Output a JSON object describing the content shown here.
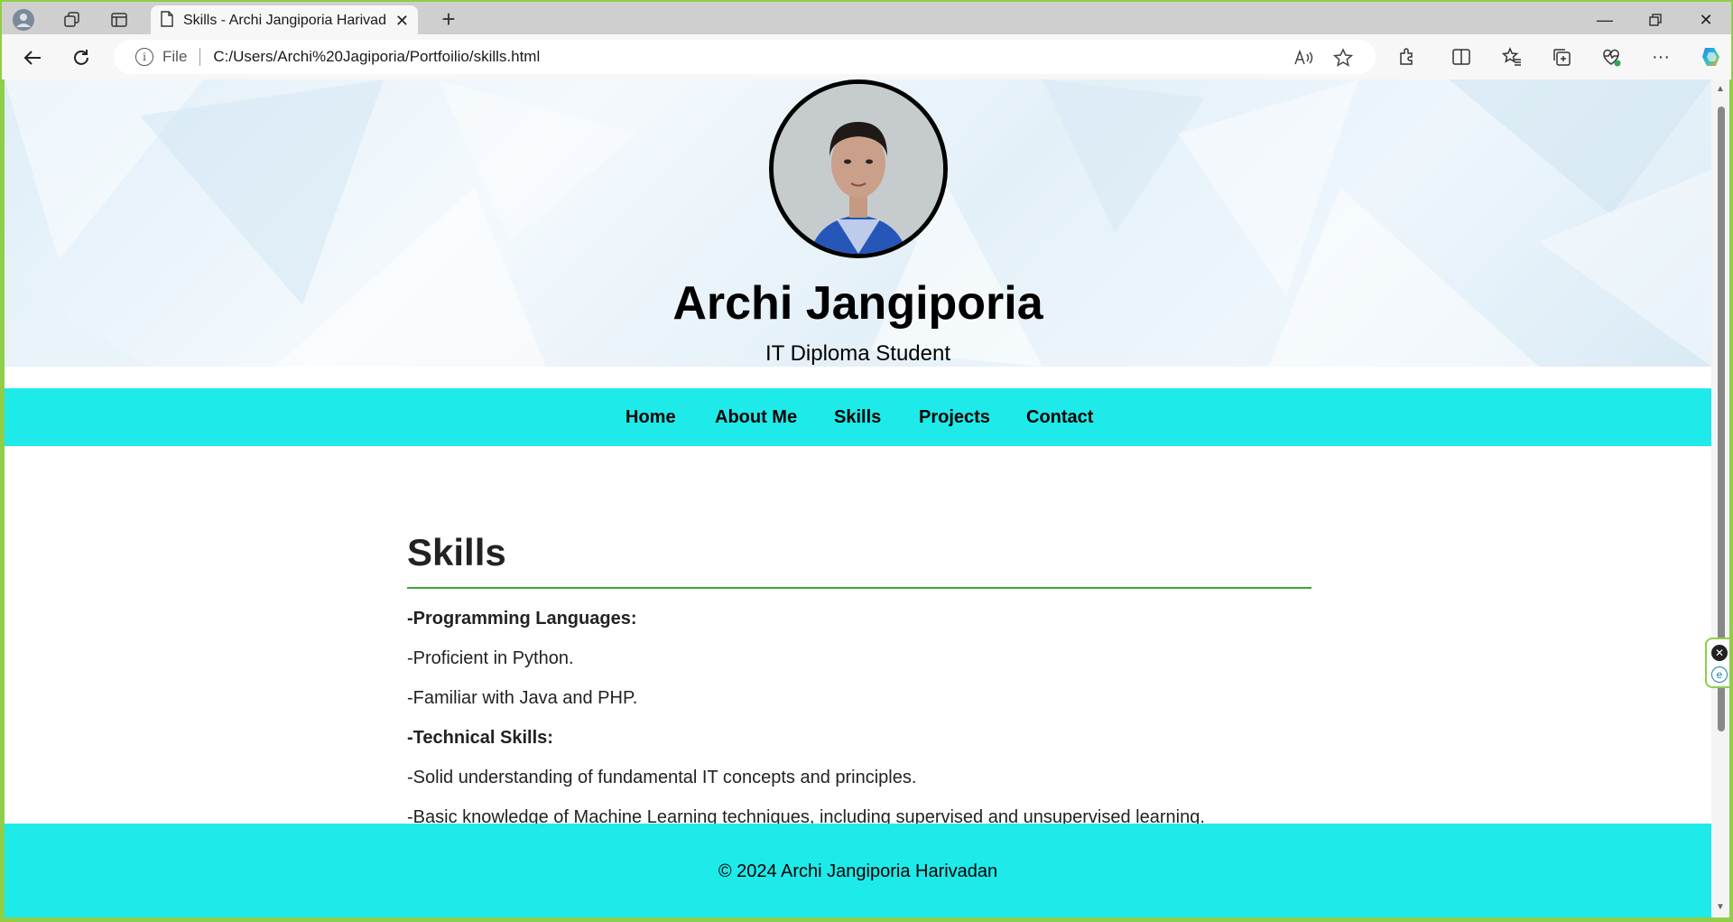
{
  "browser": {
    "tab_title": "Skills - Archi Jangiporia Harivadan",
    "address": {
      "scheme_label": "File",
      "url": "C:/Users/Archi%20Jagiporia/Portfoilio/skills.html"
    }
  },
  "hero": {
    "name": "Archi Jangiporia",
    "role": "IT Diploma Student"
  },
  "nav": {
    "items": [
      "Home",
      "About Me",
      "Skills",
      "Projects",
      "Contact"
    ]
  },
  "skills": {
    "heading": "Skills",
    "lines": [
      {
        "text": "-Programming Languages:",
        "bold": true
      },
      {
        "text": "-Proficient in Python.",
        "bold": false
      },
      {
        "text": "-Familiar with Java and PHP.",
        "bold": false
      },
      {
        "text": "-Technical Skills:",
        "bold": true
      },
      {
        "text": "-Solid understanding of fundamental IT concepts and principles.",
        "bold": false
      },
      {
        "text": "-Basic knowledge of Machine Learning techniques, including supervised and unsupervised learning.",
        "bold": false
      }
    ]
  },
  "footer": {
    "text": "© 2024 Archi Jangiporia Harivadan"
  },
  "colors": {
    "accent": "#1eeaea",
    "rule": "#3aa53a",
    "window_border": "#8fce48"
  }
}
